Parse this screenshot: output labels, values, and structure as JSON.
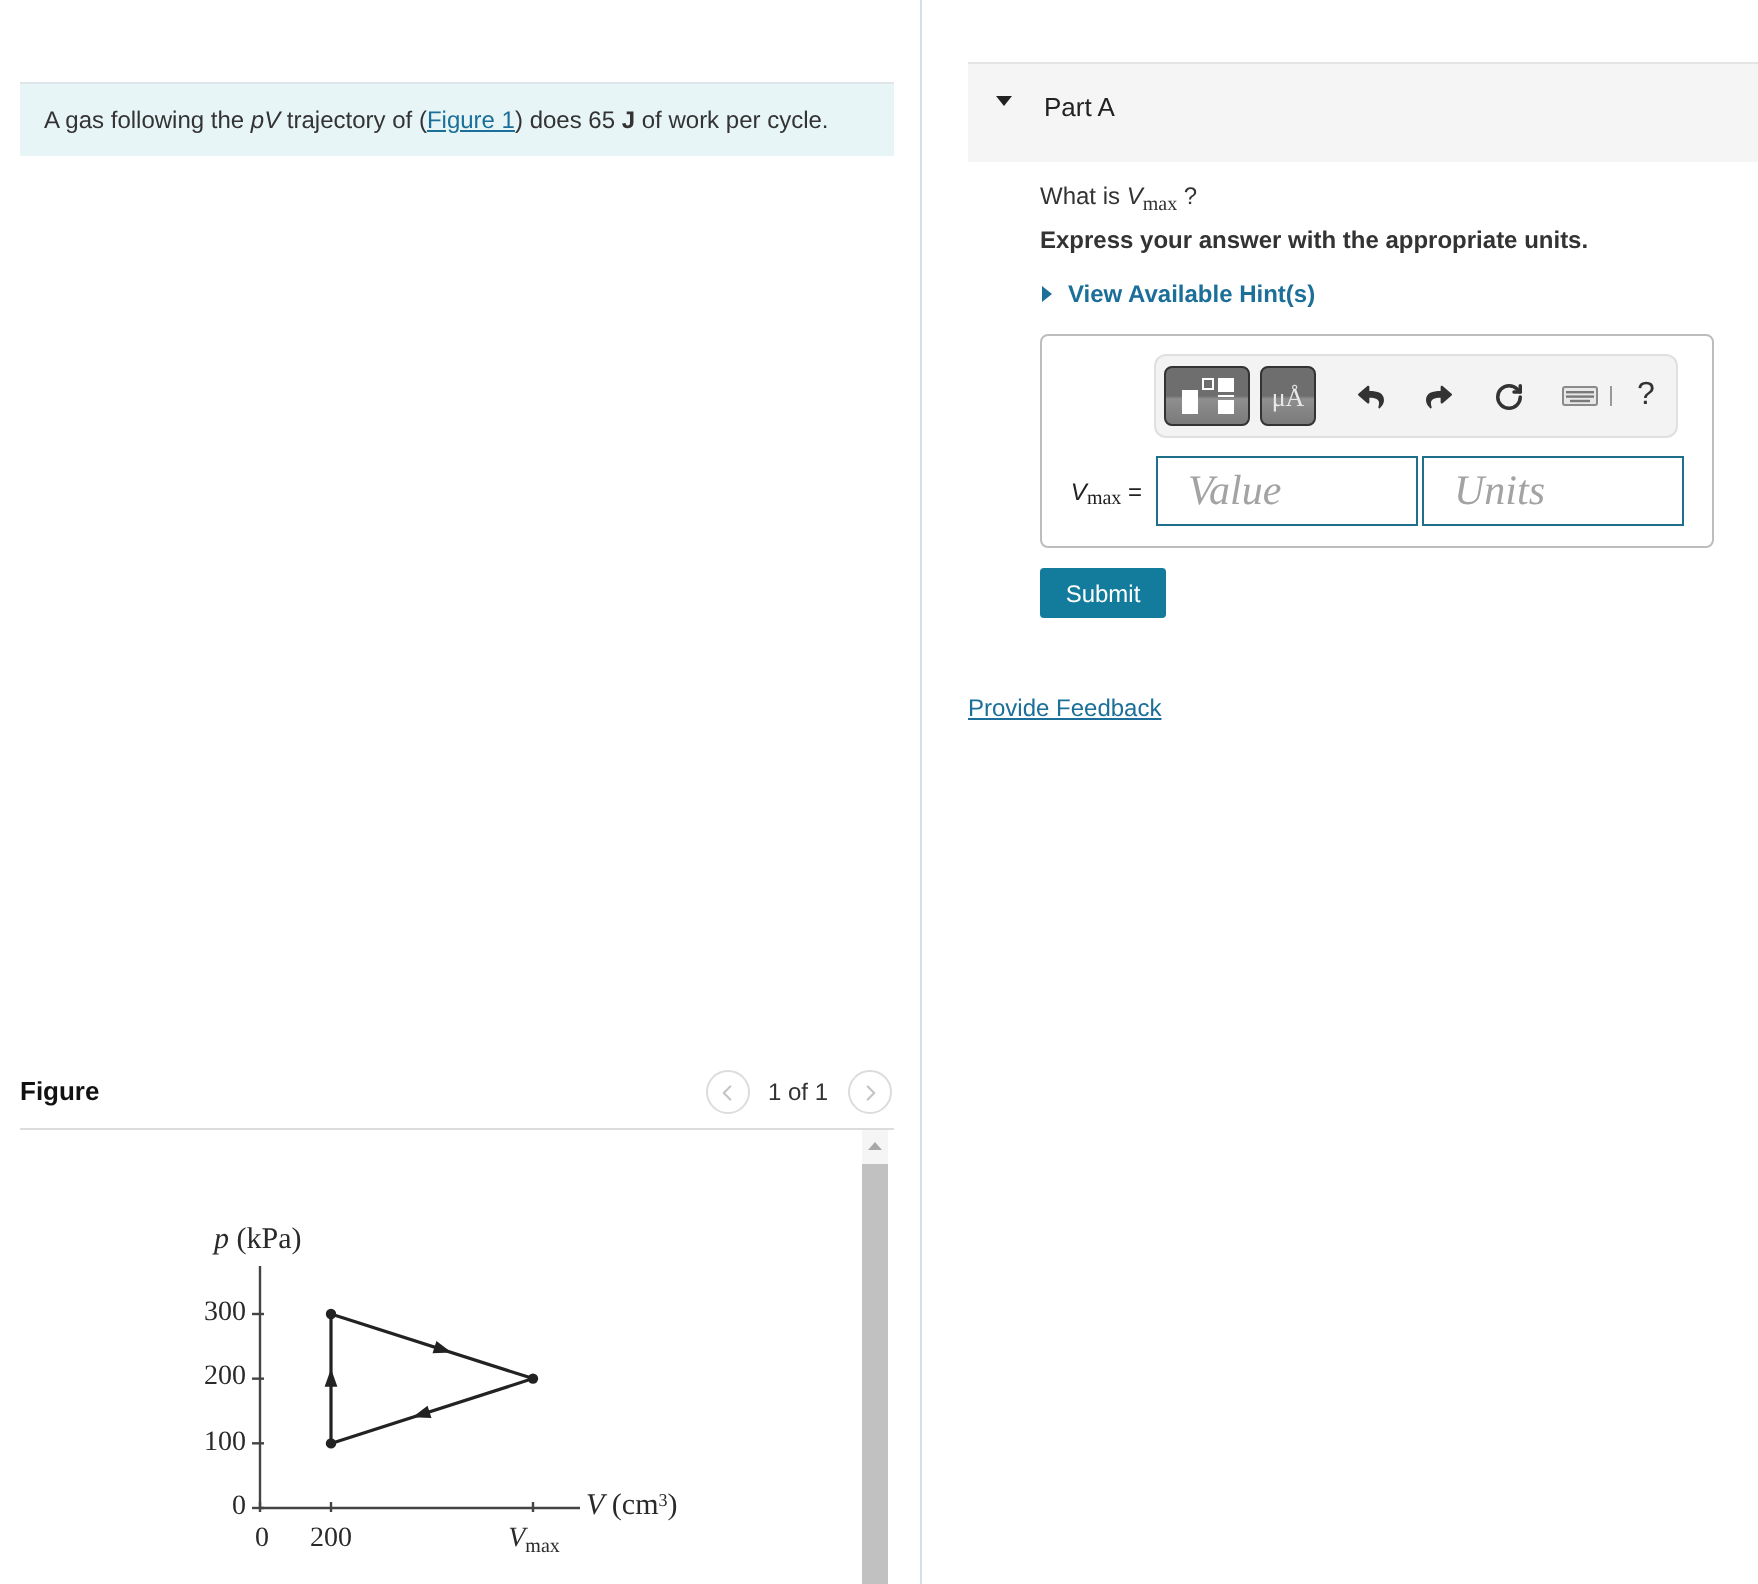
{
  "problem": {
    "before": "A gas following the *pV* trajectory of (",
    "link": "Figure 1",
    "after": ") does 65 **J** of work per cycle."
  },
  "figure": {
    "title": "Figure",
    "pager": {
      "prev_disabled": true,
      "text": "1 of 1",
      "next_disabled": true
    },
    "diagram": {
      "y_label": "*p* (kPa)",
      "y_ticks": [
        "300",
        "200",
        "100",
        "0"
      ],
      "x_label": "*V* (cm$^{3}$)",
      "x_ticks": [
        "0",
        "200"
      ],
      "x_marker": "*V*$_{max}$"
    }
  },
  "part": {
    "title": "Part A",
    "expanded": true,
    "question": "What is *V*$_{max}$ ?",
    "instruction": "Express your answer with the appropriate units.",
    "hint": {
      "label": "View Available Hint(s)",
      "expanded": false
    },
    "answer": {
      "toolbar": [
        {
          "kind": "templates"
        },
        {
          "kind": "units",
          "label": "μÅ"
        },
        {
          "kind": "undo"
        },
        {
          "kind": "redo"
        },
        {
          "kind": "reset"
        },
        {
          "kind": "keyboard"
        },
        {
          "kind": "help",
          "label": "?"
        }
      ],
      "label": "*V*$_{max}$ =",
      "value_field": {
        "placeholder": "Value"
      },
      "units_field": {
        "placeholder": "Units"
      }
    },
    "submit": "Submit"
  },
  "feedback": "Provide Feedback"
}
